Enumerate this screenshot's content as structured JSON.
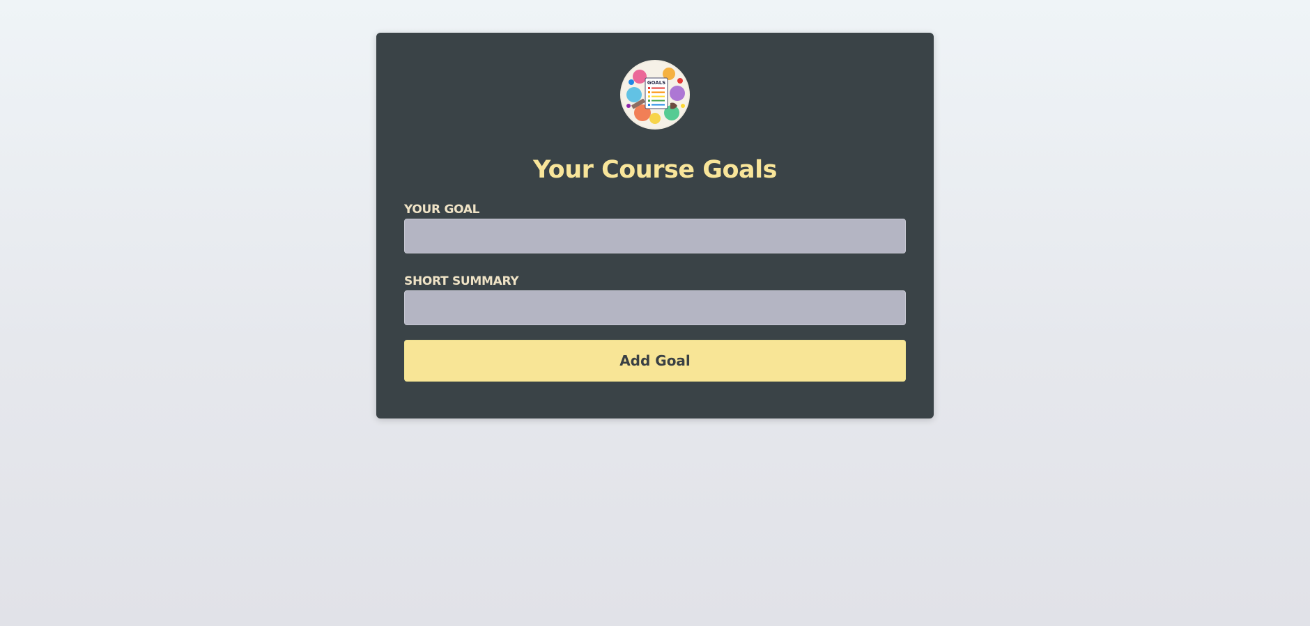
{
  "logo": {
    "icon": "goals-checklist-illustration",
    "text": "GOALS"
  },
  "form": {
    "title": "Your Course Goals",
    "goal_label": "YOUR GOAL",
    "goal_value": "",
    "summary_label": "SHORT SUMMARY",
    "summary_value": "",
    "submit_label": "Add Goal"
  },
  "colors": {
    "page_background_top": "#eff4f7",
    "page_background_bottom": "#e1e2e8",
    "card_background": "#3a4347",
    "title": "#f8e59a",
    "label": "#efe3c6",
    "input_background": "#b4b5c3",
    "button_background": "#f8e596",
    "button_text": "#3a4044"
  }
}
